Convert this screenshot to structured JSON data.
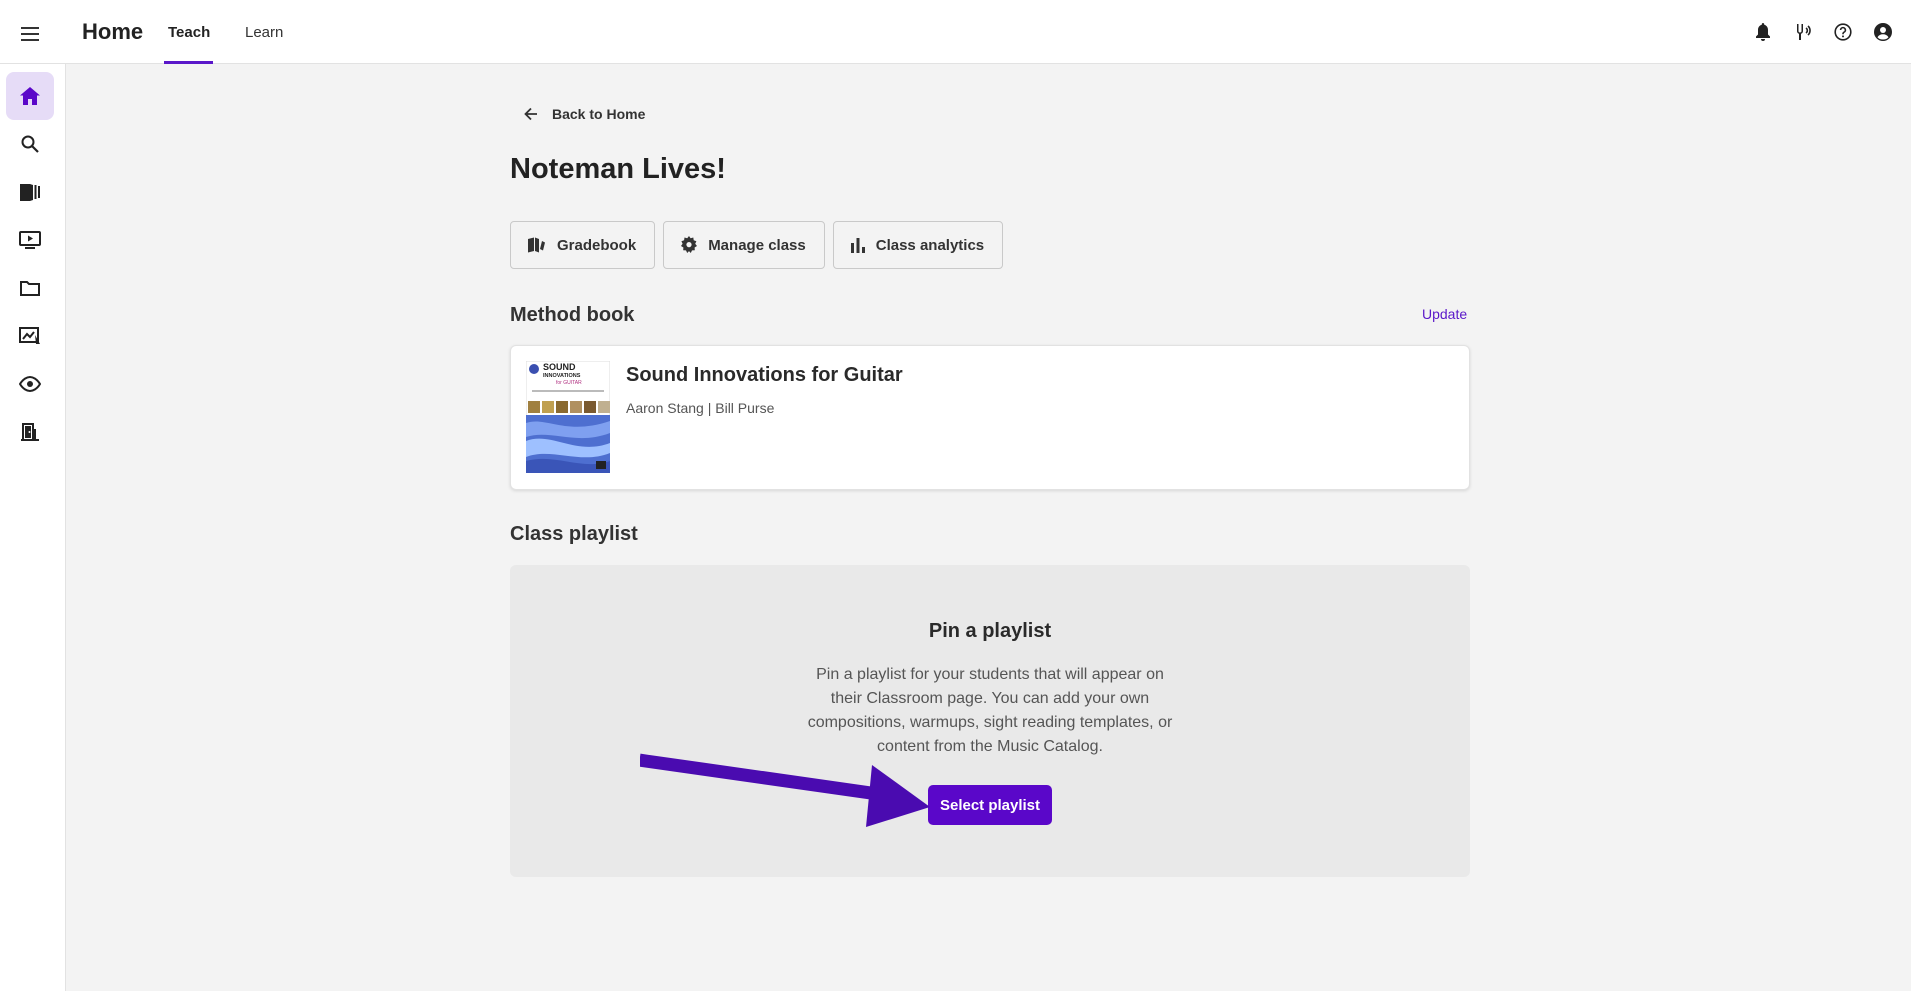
{
  "header": {
    "title": "Home",
    "tabs": [
      {
        "label": "Teach",
        "active": true
      },
      {
        "label": "Learn",
        "active": false
      }
    ],
    "icons": [
      "bell-icon",
      "tuning-fork-icon",
      "help-icon",
      "account-icon"
    ]
  },
  "sidebar": {
    "items": [
      {
        "name": "home",
        "icon": "home-icon",
        "active": true
      },
      {
        "name": "search",
        "icon": "search-icon",
        "active": false
      },
      {
        "name": "library",
        "icon": "library-icon",
        "active": false
      },
      {
        "name": "videos",
        "icon": "video-icon",
        "active": false
      },
      {
        "name": "folders",
        "icon": "folder-icon",
        "active": false
      },
      {
        "name": "sight-reading",
        "icon": "sight-reading-icon",
        "active": false
      },
      {
        "name": "ear-training",
        "icon": "ear-icon",
        "active": false
      },
      {
        "name": "classroom",
        "icon": "door-icon",
        "active": false
      }
    ]
  },
  "main": {
    "back_label": "Back to Home",
    "page_title": "Noteman Lives!",
    "actions": {
      "gradebook": "Gradebook",
      "manage_class": "Manage class",
      "class_analytics": "Class analytics"
    },
    "method_book": {
      "section_title": "Method book",
      "update_label": "Update",
      "title": "Sound Innovations for Guitar",
      "authors": "Aaron Stang | Bill Purse",
      "cover_text_1": "SOUND",
      "cover_text_2": "INNOVATIONS",
      "cover_text_3": "for GUITAR"
    },
    "class_playlist": {
      "section_title": "Class playlist",
      "pin_title": "Pin a playlist",
      "description": "Pin a playlist for your students that will appear on their Classroom page. You can add your own compositions, warmups, sight reading templates, or content from the Music Catalog.",
      "select_label": "Select playlist"
    }
  },
  "colors": {
    "accent": "#5a07c9",
    "active_bg": "#e6dcf7",
    "page_bg": "#f3f3f3",
    "arrow": "#4a0bb0"
  }
}
